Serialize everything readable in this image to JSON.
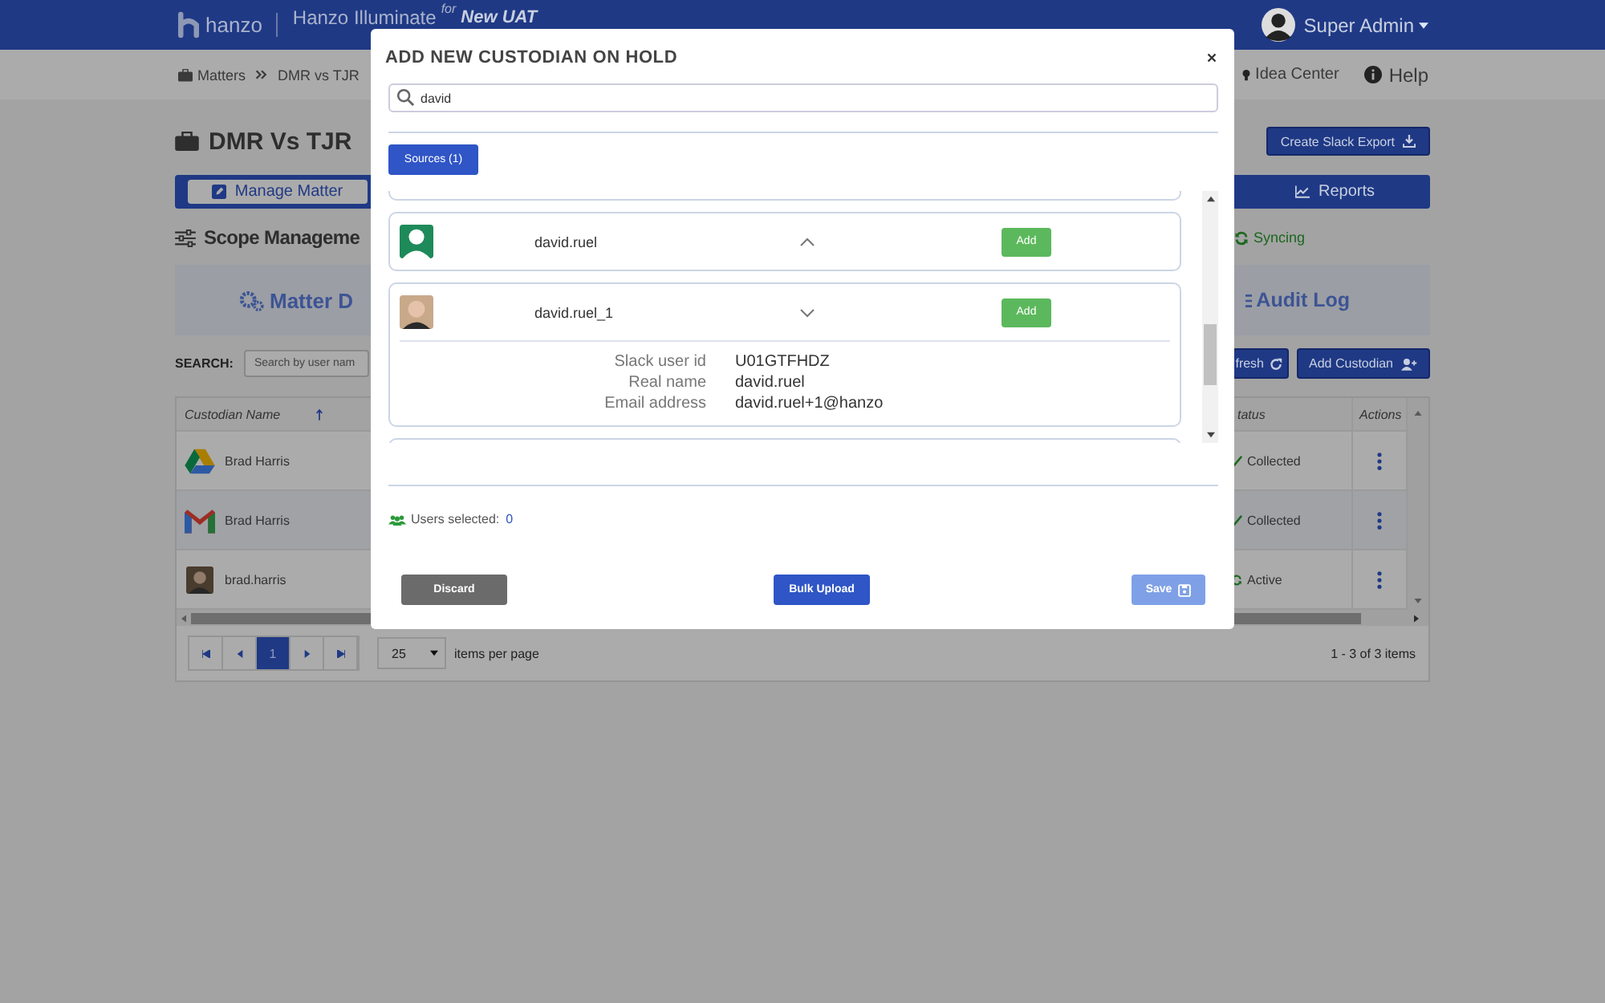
{
  "header": {
    "logo_text": "hanzo",
    "app_name": "Hanzo Illuminate",
    "app_for": "for",
    "environment": "New UAT",
    "user": "Super Admin"
  },
  "breadcrumbs": [
    {
      "label": "Matters"
    },
    {
      "label": "DMR vs TJR"
    }
  ],
  "top_links": [
    {
      "kind": "idea",
      "label": "Idea Center"
    },
    {
      "kind": "help",
      "label": "Help"
    }
  ],
  "matter": {
    "title": "DMR Vs TJR",
    "export_button": "Create Slack Export"
  },
  "tabs": [
    {
      "label": "Manage Matter",
      "selected": true
    },
    {
      "label": "Reports",
      "selected": false
    }
  ],
  "scope": {
    "heading": "Scope Manageme",
    "sync_status": "Syncing"
  },
  "panel_links": [
    {
      "kind": "gears",
      "label": "Matter D"
    },
    {
      "kind": "list",
      "label": "Audit Log"
    }
  ],
  "search": {
    "label": "SEARCH:",
    "placeholder": "Search by user nam"
  },
  "actions": [
    {
      "kind": "refresh",
      "label": "fresh"
    },
    {
      "kind": "add-user",
      "label": "Add Custodian"
    }
  ],
  "table": {
    "columns": [
      "Custodian Name",
      "tatus",
      "Actions"
    ],
    "rows": [
      {
        "kind": "drive",
        "name": "Brad Harris",
        "status": {
          "kind": "done",
          "label": "Collected"
        }
      },
      {
        "kind": "mail",
        "name": "Brad Harris",
        "status": {
          "kind": "done",
          "label": "Collected"
        }
      },
      {
        "kind": "avatar",
        "name": "brad.harris",
        "status": {
          "kind": "active",
          "label": "Active"
        }
      }
    ]
  },
  "pagination": {
    "pages": [
      {
        "label": "1",
        "selected": true
      }
    ],
    "per_page": "25",
    "per_page_label": "items per page",
    "summary": "1 - 3 of 3 items"
  },
  "modal": {
    "title": "ADD NEW CUSTODIAN ON HOLD",
    "search_value": "david",
    "sources_button": "Sources (1)",
    "results": [
      {
        "kind": "generic",
        "name": "david.ruel",
        "expanded": false,
        "add_button": "Add"
      },
      {
        "kind": "photo",
        "name": "david.ruel_1",
        "expanded": true,
        "add_button": "Add",
        "details": [
          {
            "label": "Slack user id",
            "value": "U01GTFHDZ"
          },
          {
            "label": "Real name",
            "value": "david.ruel"
          },
          {
            "label": "Email address",
            "value": "david.ruel+1@hanzo"
          }
        ]
      }
    ],
    "selected_label": "Users selected:",
    "selected_count": "0",
    "buttons": [
      {
        "kind": "discard",
        "label": "Discard",
        "disabled": false
      },
      {
        "kind": "bulk",
        "label": "Bulk Upload",
        "disabled": false
      },
      {
        "kind": "save",
        "label": "Save",
        "disabled": true
      }
    ]
  }
}
